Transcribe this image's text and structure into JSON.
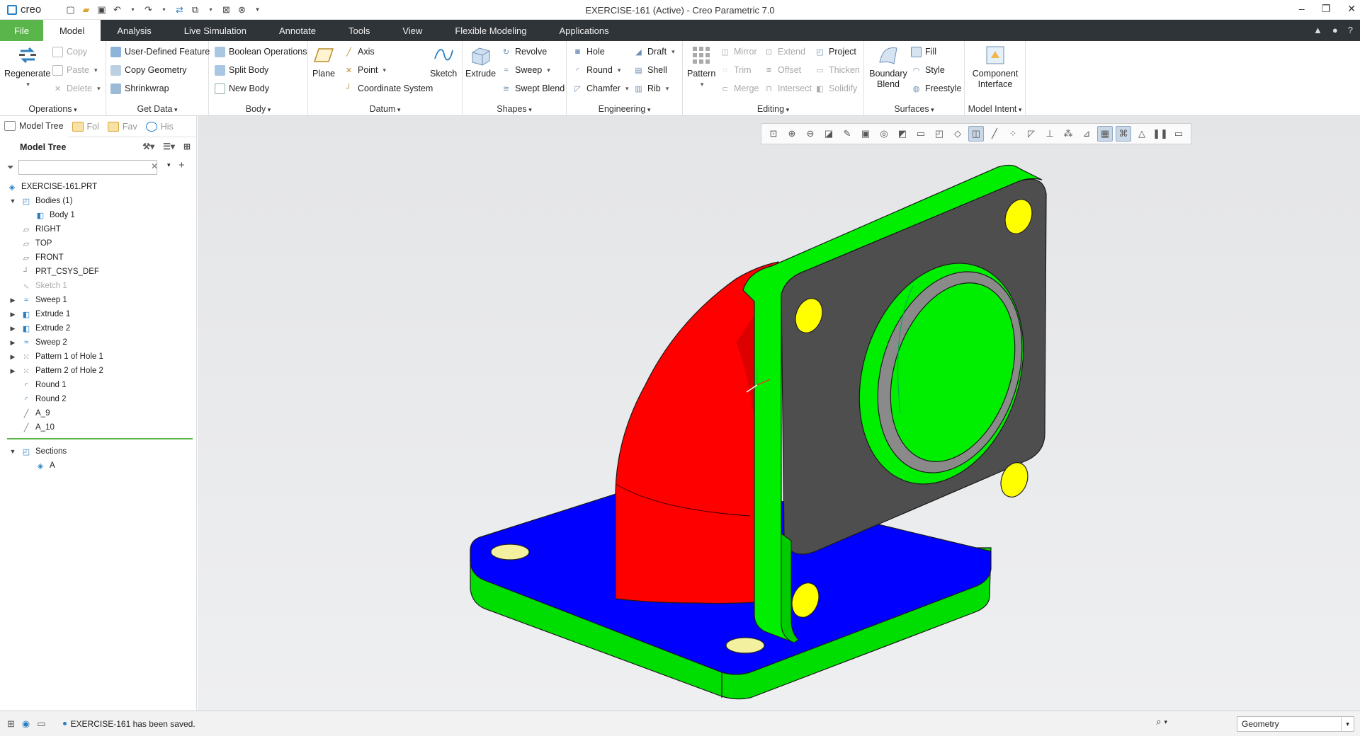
{
  "app": {
    "logo_text": "creo",
    "window_title": "EXERCISE-161 (Active) - Creo Parametric 7.0"
  },
  "tabs": [
    {
      "label": "File"
    },
    {
      "label": "Model"
    },
    {
      "label": "Analysis"
    },
    {
      "label": "Live Simulation"
    },
    {
      "label": "Annotate"
    },
    {
      "label": "Tools"
    },
    {
      "label": "View"
    },
    {
      "label": "Flexible Modeling"
    },
    {
      "label": "Applications"
    }
  ],
  "ribbon": {
    "operations": {
      "label": "Operations",
      "regenerate": "Regenerate",
      "copy": "Copy",
      "paste": "Paste",
      "delete": "Delete"
    },
    "get_data": {
      "label": "Get Data",
      "udf": "User-Defined Feature",
      "copy_geometry": "Copy Geometry",
      "shrinkwrap": "Shrinkwrap"
    },
    "body": {
      "label": "Body",
      "boolean": "Boolean Operations",
      "split": "Split Body",
      "new": "New Body"
    },
    "datum": {
      "label": "Datum",
      "plane": "Plane",
      "axis": "Axis",
      "point": "Point",
      "csys": "Coordinate System",
      "sketch": "Sketch"
    },
    "shapes": {
      "label": "Shapes",
      "extrude": "Extrude",
      "revolve": "Revolve",
      "sweep": "Sweep",
      "swept_blend": "Swept Blend"
    },
    "engineering": {
      "label": "Engineering",
      "hole": "Hole",
      "round": "Round",
      "chamfer": "Chamfer",
      "draft": "Draft",
      "shell": "Shell",
      "rib": "Rib"
    },
    "editing": {
      "label": "Editing",
      "pattern": "Pattern",
      "mirror": "Mirror",
      "trim": "Trim",
      "merge": "Merge",
      "extend": "Extend",
      "offset": "Offset",
      "intersect": "Intersect",
      "project": "Project",
      "thicken": "Thicken",
      "solidify": "Solidify"
    },
    "surfaces": {
      "label": "Surfaces",
      "boundary_blend": "Boundary Blend",
      "fill": "Fill",
      "style": "Style",
      "freestyle": "Freestyle"
    },
    "model_intent": {
      "label": "Model Intent",
      "component_interface": "Component Interface"
    }
  },
  "panel": {
    "tabs": [
      {
        "label": "Model Tree"
      },
      {
        "label": "Fol"
      },
      {
        "label": "Fav"
      },
      {
        "label": "His"
      }
    ],
    "tree_title": "Model Tree",
    "filter_placeholder": ""
  },
  "tree": [
    {
      "label": "EXERCISE-161.PRT"
    },
    {
      "label": "Bodies (1)"
    },
    {
      "label": "Body 1"
    },
    {
      "label": "RIGHT"
    },
    {
      "label": "TOP"
    },
    {
      "label": "FRONT"
    },
    {
      "label": "PRT_CSYS_DEF"
    },
    {
      "label": "Sketch 1"
    },
    {
      "label": "Sweep 1"
    },
    {
      "label": "Extrude 1"
    },
    {
      "label": "Extrude 2"
    },
    {
      "label": "Sweep 2"
    },
    {
      "label": "Pattern 1 of Hole 1"
    },
    {
      "label": "Pattern 2 of Hole 2"
    },
    {
      "label": "Round 1"
    },
    {
      "label": "Round 2"
    },
    {
      "label": "A_9"
    },
    {
      "label": "A_10"
    },
    {
      "label": "Sections"
    },
    {
      "label": "A"
    }
  ],
  "status": {
    "message": "EXERCISE-161 has been saved.",
    "filter_value": "Geometry"
  },
  "colors": {
    "file_tab": "#5ab54a",
    "tab_bar": "#2f3438",
    "flange_green": "#00ee00",
    "elbow_red": "#ff0000",
    "base_blue": "#0000ff",
    "face_gray": "#4a4a4a",
    "hole_yellow": "#ffff00"
  }
}
